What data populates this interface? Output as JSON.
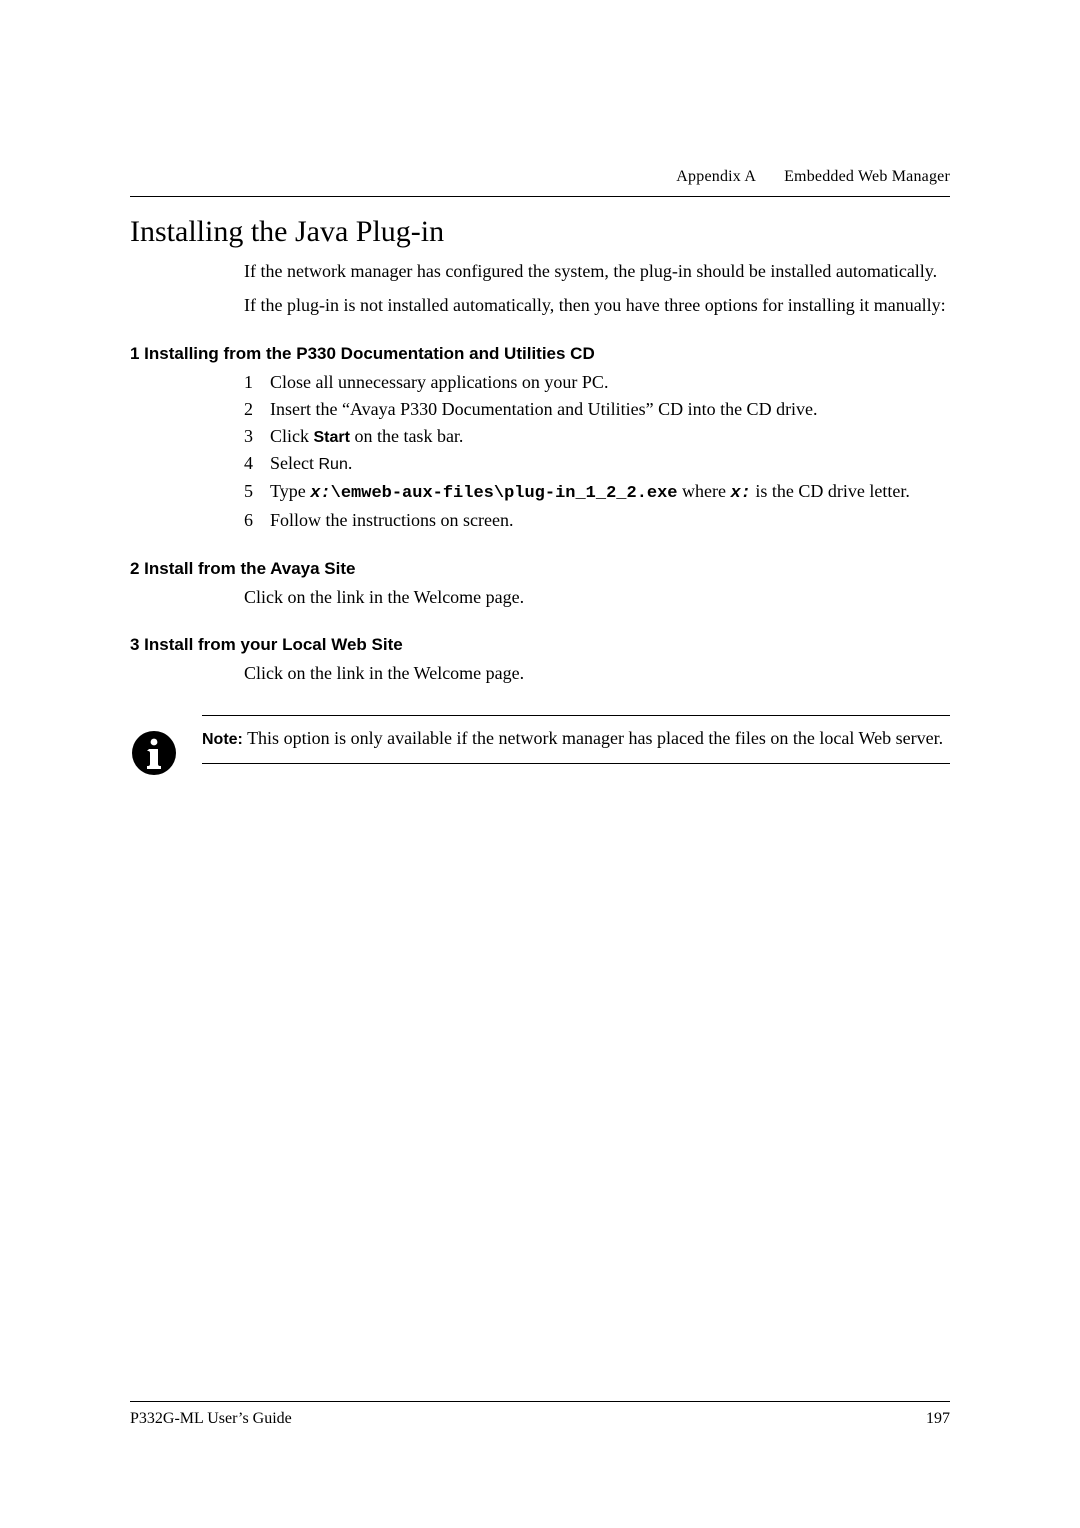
{
  "header": {
    "appendix": "Appendix A",
    "title": "Embedded Web Manager"
  },
  "section": {
    "title": "Installing the Java Plug-in",
    "intro1": "If the network manager has configured the system, the plug-in should be installed automatically.",
    "intro2": "If the plug-in is not installed automatically, then you have three options for installing it manually:"
  },
  "sub1": {
    "heading": "1  Installing from the P330 Documentation and Utilities CD",
    "steps": {
      "s1": {
        "n": "1",
        "text": "Close all unnecessary applications on your PC."
      },
      "s2": {
        "n": "2",
        "text": "Insert the “Avaya P330 Documentation and Utilities” CD into the CD drive."
      },
      "s3": {
        "n": "3",
        "pre": "Click ",
        "bold": "Start",
        "post": " on the task bar."
      },
      "s4": {
        "n": "4",
        "pre": "Select ",
        "sans": "Run",
        "post": "."
      },
      "s5": {
        "n": "5",
        "pre": "Type ",
        "x1": "x:",
        "cmd": "\\emweb-aux-files\\plug-in_1_2_2.exe",
        "mid": " where ",
        "x2": "x:",
        "post": " is the CD drive letter."
      },
      "s6": {
        "n": "6",
        "text": "Follow the instructions on screen."
      }
    }
  },
  "sub2": {
    "heading": "2  Install from the Avaya Site",
    "body": "Click on the link in the Welcome page."
  },
  "sub3": {
    "heading": "3  Install from your Local Web Site",
    "body": "Click on the link in the Welcome page."
  },
  "note": {
    "label": "Note:",
    "text": "  This option is only available if the network manager has placed the files on the local Web server."
  },
  "footer": {
    "left": "P332G-ML User’s Guide",
    "right": "197"
  },
  "icons": {
    "info": "info-icon"
  }
}
